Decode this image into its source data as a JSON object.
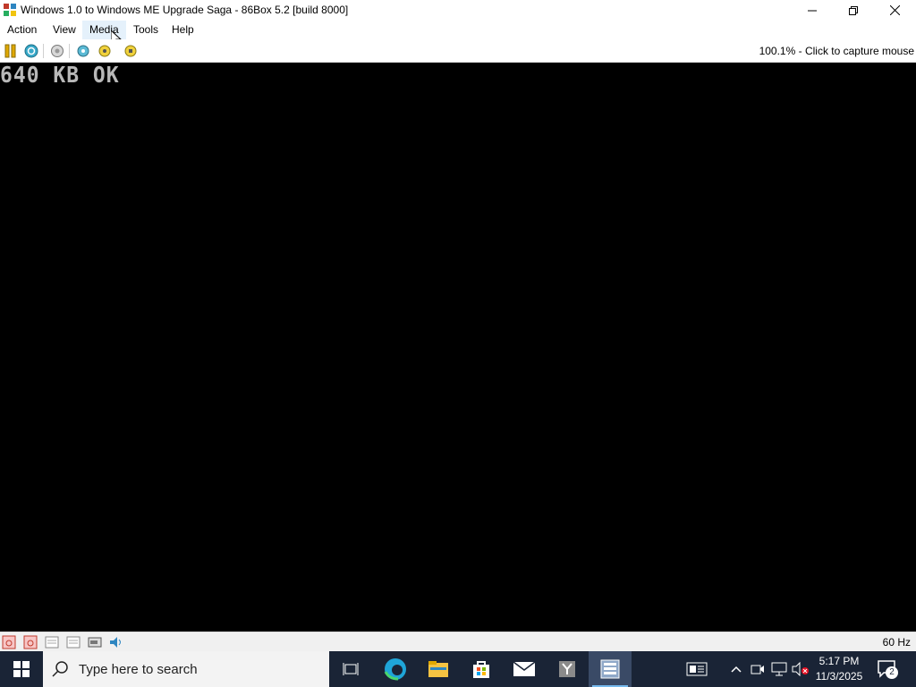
{
  "window": {
    "title": "Windows 1.0 to Windows ME Upgrade Saga - 86Box 5.2 [build 8000]",
    "controls": [
      "minimize-icon",
      "restore-icon",
      "close-icon"
    ]
  },
  "menu": {
    "items": [
      {
        "label": "Action"
      },
      {
        "label": "View"
      },
      {
        "label": "Media"
      },
      {
        "label": "Tools"
      },
      {
        "label": "Help"
      }
    ]
  },
  "toolbar": {
    "icons": [
      "pause-icon",
      "reset-icon",
      "ctrl-alt-del-icon",
      "settings-icon",
      "load-state-icon",
      "save-state-icon"
    ],
    "status_text": "100.1% - Click to capture mouse"
  },
  "screen": {
    "text": "640 KB OK"
  },
  "statusbar": {
    "icons": [
      "floppy-a-icon",
      "floppy-b-icon",
      "cdrom-1-icon",
      "cdrom-2-icon",
      "hard-disk-icon",
      "sound-icon"
    ],
    "refresh_rate": "60 Hz"
  },
  "taskbar": {
    "search_placeholder": "Type here to search",
    "apps": [
      "task-view-icon",
      "edge-icon",
      "file-explorer-icon",
      "store-icon",
      "mail-icon",
      "y-app-icon",
      "86box-icon"
    ],
    "tray": [
      "news-icon",
      "chevron-up-icon",
      "meet-icon",
      "network-icon",
      "volume-muted-icon"
    ],
    "time": "5:17 PM",
    "date": "11/3/2025",
    "notification_count": "2",
    "colors": {
      "taskbar_bg": "#1a2436",
      "accent": "#76b9ed"
    }
  }
}
